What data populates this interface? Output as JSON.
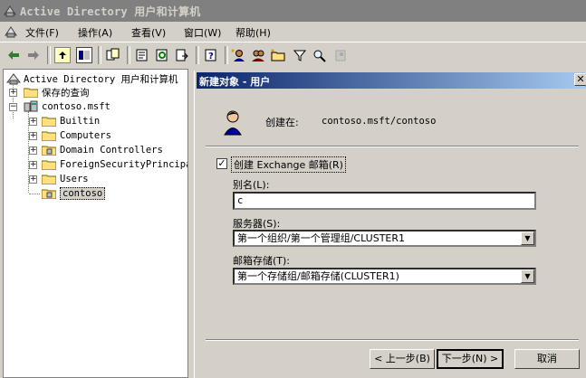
{
  "window": {
    "title": "Active Directory 用户和计算机"
  },
  "menu": {
    "items": [
      "文件(F)",
      "操作(A)",
      "查看(V)",
      "窗口(W)",
      "帮助(H)"
    ]
  },
  "toolbar": {
    "icons": [
      "back-arrow-icon",
      "forward-arrow-icon",
      "up-folder-icon",
      "show-hide-tree-icon",
      "copy-icon",
      "properties-icon",
      "refresh-icon",
      "export-list-icon",
      "help-icon",
      "new-user-icon",
      "new-group-icon",
      "new-ou-icon",
      "filter-icon",
      "find-icon",
      "add-to-group-icon"
    ]
  },
  "tree": {
    "root": "Active Directory 用户和计算机",
    "saved_queries": "保存的查询",
    "domain": "contoso.msft",
    "children": [
      "Builtin",
      "Computers",
      "Domain Controllers",
      "ForeignSecurityPrincipa",
      "Users",
      "contoso"
    ]
  },
  "dialog": {
    "title": "新建对象 - 用户",
    "created_in_label": "创建在:",
    "created_in_value": "contoso.msft/contoso",
    "create_mailbox_label": "创建 Exchange 邮箱(R)",
    "create_mailbox_checked": true,
    "alias_label": "别名(L):",
    "alias_value": "c",
    "server_label": "服务器(S):",
    "server_value": "第一个组织/第一个管理组/CLUSTER1",
    "store_label": "邮箱存储(T):",
    "store_value": "第一个存储组/邮箱存储(CLUSTER1)",
    "back_button": "< 上一步(B)",
    "next_button": "下一步(N) >",
    "cancel_button": "取消"
  }
}
